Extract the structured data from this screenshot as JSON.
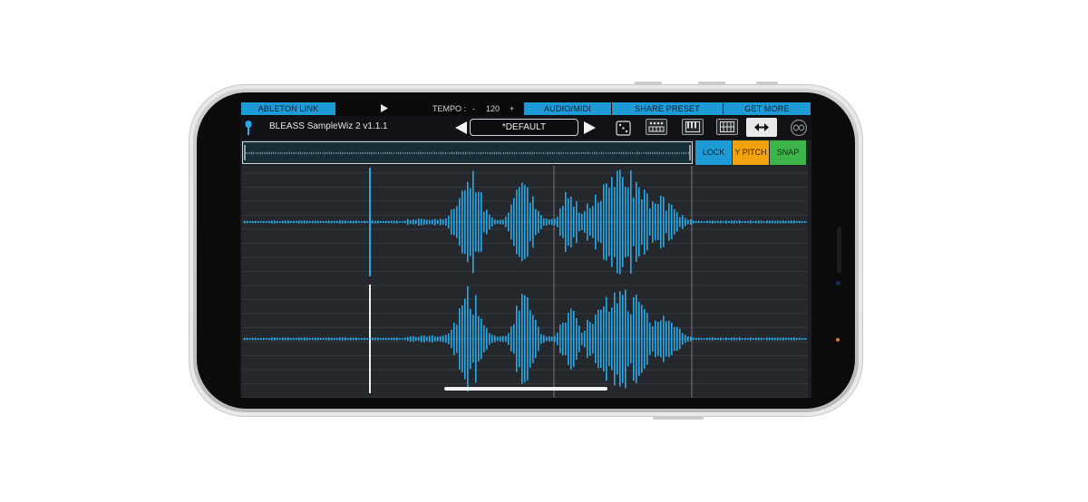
{
  "colors": {
    "accent": "#1e9ad6",
    "waveform": "#2aa9e8",
    "lock": "#1e9ad6",
    "ypitch": "#f2a20e",
    "snap": "#3db54a",
    "selected_tool": "#e9e9e9"
  },
  "topbar": {
    "ableton_link": "ABLETON LINK",
    "play_icon": "play-icon",
    "tempo_label": "TEMPO :",
    "tempo_minus": "-",
    "tempo_value": "120",
    "tempo_plus": "+",
    "audio_midi": "AUDIO/MIDI",
    "share_preset": "SHARE PRESET",
    "get_more_presets": "GET MORE PRESETS!"
  },
  "header": {
    "app_name": "BLEASS SampleWiz 2 v1.1.1",
    "preset_name": "*DEFAULT",
    "prev_icon": "triangle-left-icon",
    "next_icon": "triangle-right-icon",
    "tools": [
      "dice-icon",
      "keyboard-pads-icon",
      "piano-keys-icon",
      "sequencer-grid-icon",
      "horizontal-arrows-icon",
      "bleass-logo-icon"
    ]
  },
  "controls": {
    "lock": "LOCK",
    "ypitch": "Y PITCH",
    "snap": "SNAP"
  }
}
